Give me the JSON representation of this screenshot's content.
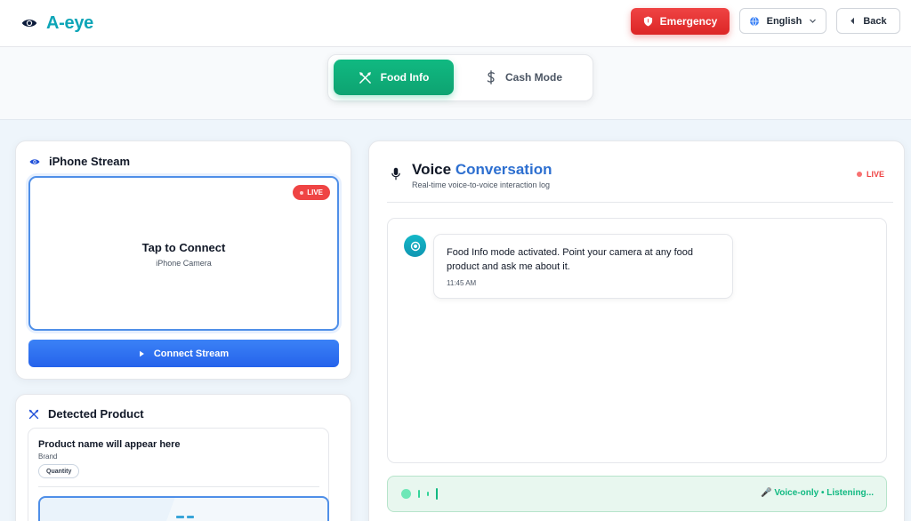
{
  "app": {
    "name": "A-eye"
  },
  "header": {
    "emergency_label": "Emergency",
    "language_label": "English",
    "back_label": "Back"
  },
  "modes": {
    "food_label": "Food Info",
    "cash_label": "Cash Mode",
    "active": "Food Info"
  },
  "stream": {
    "title": "iPhone Stream",
    "live_label": "LIVE",
    "tap_title": "Tap to Connect",
    "tap_sub": "iPhone Camera",
    "connect_label": "Connect Stream"
  },
  "product": {
    "title": "Detected Product",
    "name_placeholder": "Product name will appear here",
    "brand": "Brand",
    "quantity": "Quantity"
  },
  "voice": {
    "title_part1": "Voice ",
    "title_part2": "Conversation",
    "subtitle": "Real-time voice-to-voice interaction log",
    "live_label": "LIVE",
    "messages": [
      {
        "text": "Food Info mode activated. Point your camera at any food product and ask me about it.",
        "time": "11:45 AM"
      }
    ],
    "status": "🎤 Voice-only • Listening..."
  },
  "colors": {
    "brand": "#0ea5b7",
    "emergency": "#ef4444",
    "food_mode": "#10b981",
    "primary": "#3b82f6",
    "listening": "#10b981"
  }
}
